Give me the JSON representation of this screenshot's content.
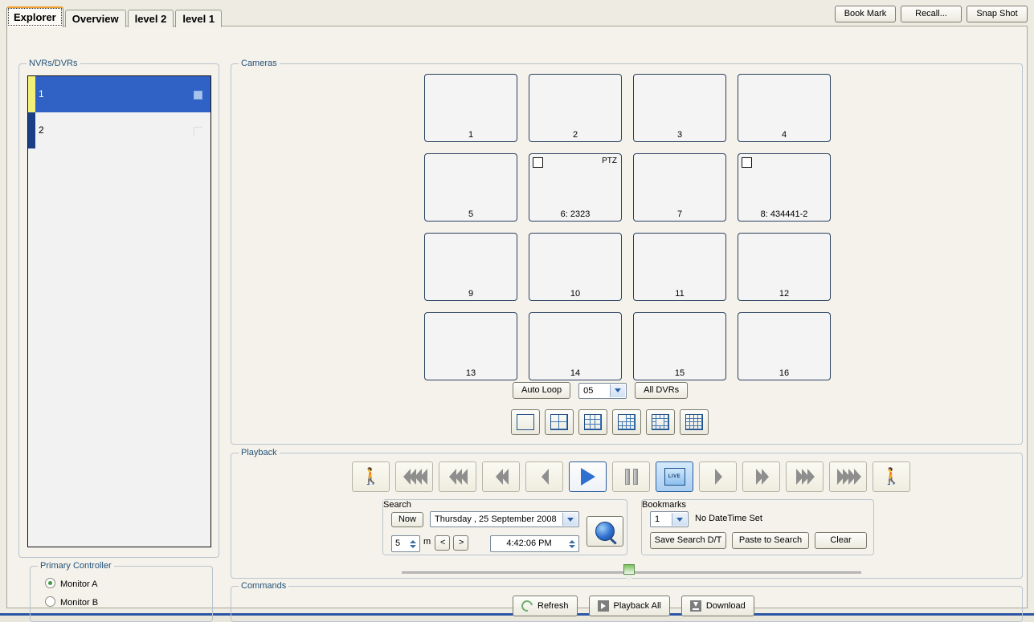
{
  "tabs": [
    {
      "label": "Explorer",
      "active": true
    },
    {
      "label": "Overview",
      "active": false
    },
    {
      "label": "level 2",
      "active": false
    },
    {
      "label": "level 1",
      "active": false
    }
  ],
  "top_buttons": [
    {
      "label": "Book Mark"
    },
    {
      "label": "Recall..."
    },
    {
      "label": "Snap Shot"
    }
  ],
  "nvr_panel": {
    "title": "NVRs/DVRs",
    "items": [
      {
        "label": "1",
        "selected": true
      },
      {
        "label": "2",
        "selected": false
      }
    ]
  },
  "primary_controller": {
    "title": "Primary Controller",
    "options": [
      {
        "label": "Monitor A",
        "selected": true
      },
      {
        "label": "Monitor B",
        "selected": false
      }
    ]
  },
  "cameras": {
    "title": "Cameras",
    "cells": [
      {
        "label": "1",
        "ptz": "",
        "checkbox": false
      },
      {
        "label": "2",
        "ptz": "",
        "checkbox": false
      },
      {
        "label": "3",
        "ptz": "",
        "checkbox": false
      },
      {
        "label": "4",
        "ptz": "",
        "checkbox": false
      },
      {
        "label": "5",
        "ptz": "",
        "checkbox": false
      },
      {
        "label": "6: 2323",
        "ptz": "PTZ",
        "checkbox": true
      },
      {
        "label": "7",
        "ptz": "",
        "checkbox": false
      },
      {
        "label": "8: 434441-2",
        "ptz": "",
        "checkbox": true
      },
      {
        "label": "9",
        "ptz": "",
        "checkbox": false
      },
      {
        "label": "10",
        "ptz": "",
        "checkbox": false
      },
      {
        "label": "11",
        "ptz": "",
        "checkbox": false
      },
      {
        "label": "12",
        "ptz": "",
        "checkbox": false
      },
      {
        "label": "13",
        "ptz": "",
        "checkbox": false
      },
      {
        "label": "14",
        "ptz": "",
        "checkbox": false
      },
      {
        "label": "15",
        "ptz": "",
        "checkbox": false
      },
      {
        "label": "16",
        "ptz": "",
        "checkbox": false
      }
    ],
    "auto_loop_label": "Auto Loop",
    "loop_interval": "05",
    "all_dvrs_label": "All DVRs",
    "layout_buttons": [
      {
        "name": "layout-1x1",
        "cols": 1,
        "rows": 1
      },
      {
        "name": "layout-2x2",
        "cols": 2,
        "rows": 2
      },
      {
        "name": "layout-3x3",
        "cols": 3,
        "rows": 3
      },
      {
        "name": "layout-1plus",
        "cols": 4,
        "rows": 4
      },
      {
        "name": "layout-center-large",
        "cols": 4,
        "rows": 4
      },
      {
        "name": "layout-4x4",
        "cols": 4,
        "rows": 4
      }
    ]
  },
  "playback": {
    "title": "Playback",
    "transport": [
      {
        "name": "step-back-frame",
        "icon": "runner-left",
        "state": "normal"
      },
      {
        "name": "rewind-4x",
        "icon": "chev-left-4",
        "state": "normal"
      },
      {
        "name": "rewind-3x",
        "icon": "chev-left-3",
        "state": "normal"
      },
      {
        "name": "rewind-2x",
        "icon": "chev-left-2",
        "state": "normal"
      },
      {
        "name": "rewind-1x",
        "icon": "chev-left-1",
        "state": "normal"
      },
      {
        "name": "play",
        "icon": "play-triangle",
        "state": "outlined"
      },
      {
        "name": "pause",
        "icon": "pause-bars",
        "state": "normal"
      },
      {
        "name": "live",
        "icon": "live-box",
        "state": "highlighted",
        "text": "LIVE"
      },
      {
        "name": "forward-1x",
        "icon": "chev-right-1",
        "state": "normal"
      },
      {
        "name": "forward-2x",
        "icon": "chev-right-2",
        "state": "normal"
      },
      {
        "name": "forward-3x",
        "icon": "chev-right-3",
        "state": "normal"
      },
      {
        "name": "forward-4x",
        "icon": "chev-right-4",
        "state": "normal"
      },
      {
        "name": "step-forward-frame",
        "icon": "runner-right",
        "state": "normal"
      }
    ]
  },
  "search": {
    "title": "Search",
    "now_label": "Now",
    "date_value": "Thursday  , 25 September 2008",
    "interval_value": "5",
    "interval_unit": "m",
    "prev_label": "<",
    "next_label": ">",
    "time_value": "4:42:06 PM",
    "search_icon": "magnifier-icon"
  },
  "bookmarks": {
    "title": "Bookmarks",
    "selected_index": "1",
    "status_text": "No DateTime Set",
    "save_label": "Save Search D/T",
    "paste_label": "Paste to Search",
    "clear_label": "Clear"
  },
  "commands": {
    "title": "Commands",
    "buttons": [
      {
        "label": "Refresh",
        "icon": "refresh-icon"
      },
      {
        "label": "Playback All",
        "icon": "play-icon"
      },
      {
        "label": "Download",
        "icon": "download-icon"
      }
    ]
  },
  "colors": {
    "selection_blue": "#2f62c4",
    "accent_orange": "#f0a030",
    "group_label": "#24527a",
    "camera_border": "#2b4161",
    "thumb_green": "#79c25a"
  }
}
